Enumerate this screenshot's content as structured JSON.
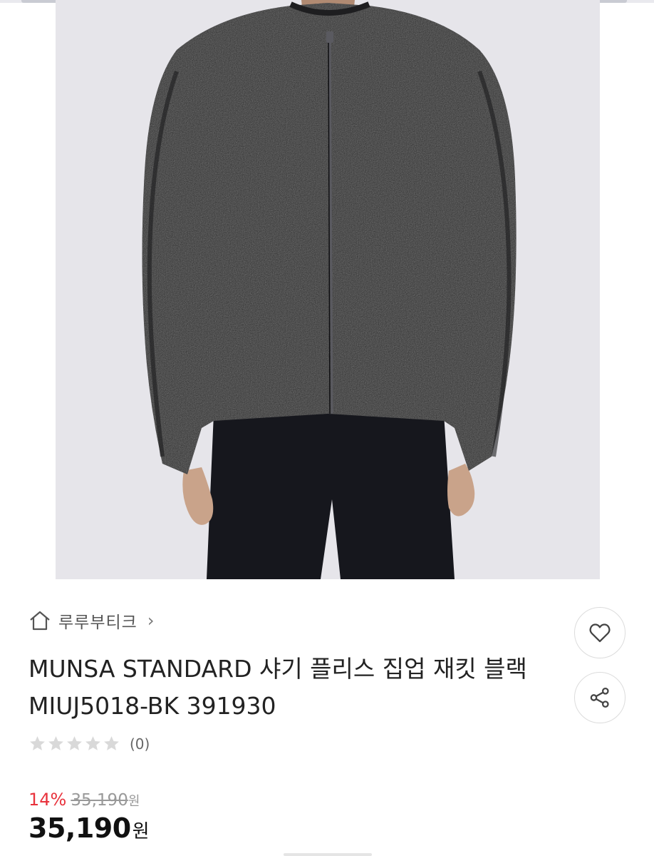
{
  "product_image": {
    "icon": "fleece-jacket-photo",
    "background_color": "#e6e5ea",
    "garment_color": "#2a2a2c"
  },
  "shop": {
    "icon": "home-icon",
    "name": "루루부티크",
    "chevron": "›"
  },
  "product": {
    "title": "MUNSA STANDARD 샤기 플리스 집업 재킷 블랙 MIUJ5018-BK 391930"
  },
  "rating": {
    "stars": 0,
    "max_stars": 5,
    "review_count": "(0)"
  },
  "price": {
    "discount_rate": "14%",
    "original_price": "35,190",
    "original_unit": "원",
    "sale_price": "35,190",
    "sale_unit": "원",
    "accent_color": "#e8323c"
  },
  "actions": {
    "like_icon": "heart-icon",
    "share_icon": "share-icon"
  }
}
